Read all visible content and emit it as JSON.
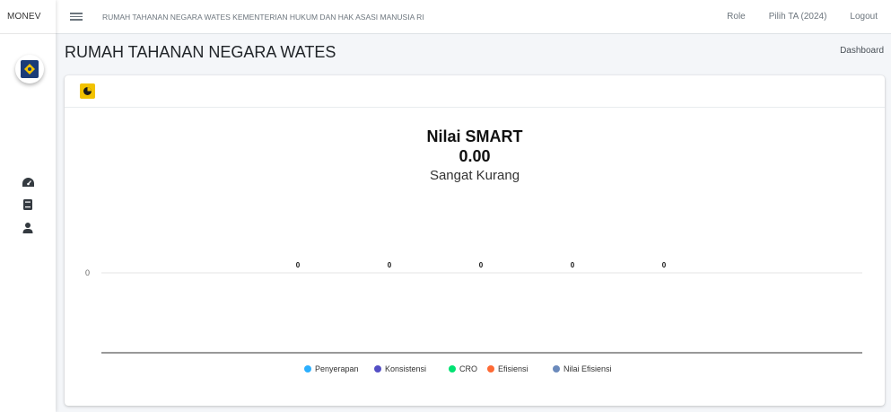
{
  "app": {
    "brand": "MONEV"
  },
  "navbar": {
    "title": "RUMAH TAHANAN NEGARA WATES KEMENTERIAN HUKUM DAN HAK ASASI MANUSIA RI",
    "role": "Role",
    "year": "Pilih TA (2024)",
    "logout": "Logout"
  },
  "page": {
    "title": "RUMAH TAHANAN NEGARA WATES",
    "breadcrumb": "Dashboard"
  },
  "chart_data": {
    "type": "bar",
    "title": "Nilai SMART",
    "subtitle_value": "0.00",
    "subtitle_category": "Sangat Kurang",
    "series": [
      {
        "name": "Penyerapan",
        "value": 0,
        "color": "#2caffe"
      },
      {
        "name": "Konsistensi",
        "value": 0,
        "color": "#544fc5"
      },
      {
        "name": "CRO",
        "value": 0,
        "color": "#00e272"
      },
      {
        "name": "Efisiensi",
        "value": 0,
        "color": "#fe6a35"
      },
      {
        "name": "Nilai Efisiensi",
        "value": 0,
        "color": "#6b8abc"
      }
    ],
    "yticks": [
      "0"
    ],
    "legend": "bottom-center",
    "grid": true
  }
}
